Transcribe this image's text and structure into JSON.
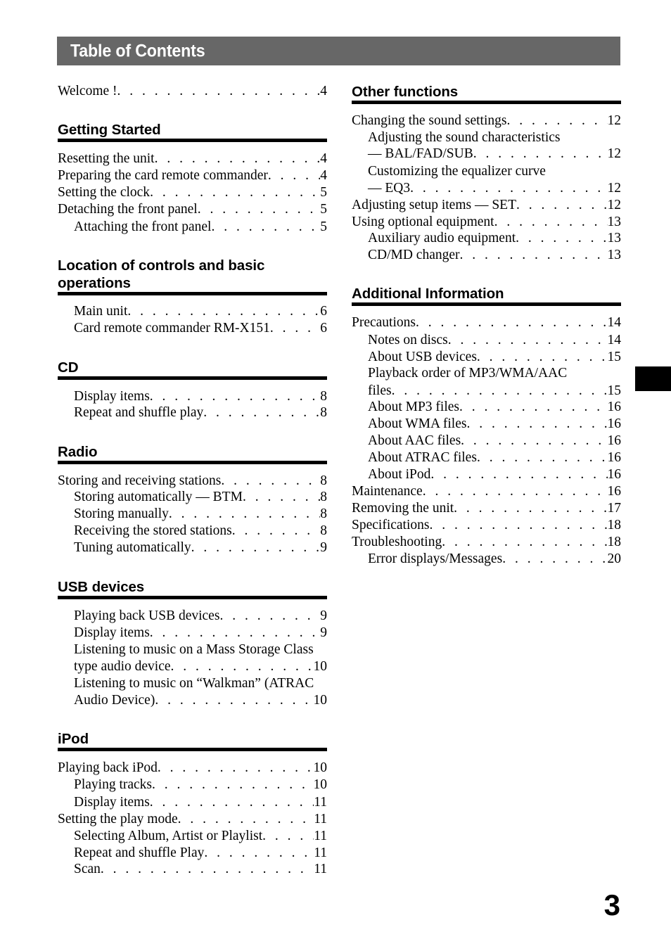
{
  "header": {
    "title": "Table of Contents"
  },
  "folio": "3",
  "columns": {
    "left": [
      {
        "type": "entries",
        "entries": [
          {
            "text": "Welcome !",
            "page": "4",
            "level": 0
          }
        ]
      },
      {
        "type": "section",
        "heading": "Getting Started",
        "entries": [
          {
            "text": "Resetting the unit",
            "page": "4",
            "level": 0,
            "tight": true
          },
          {
            "text": "Preparing the card remote commander",
            "page": "4",
            "level": 0
          },
          {
            "text": "Setting the clock",
            "page": "5",
            "level": 0
          },
          {
            "text": "Detaching the front panel",
            "page": "5",
            "level": 0
          },
          {
            "text": "Attaching the front panel",
            "page": "5",
            "level": 1
          }
        ]
      },
      {
        "type": "section",
        "heading": "Location of controls and basic\noperations",
        "entries": [
          {
            "text": "Main unit",
            "page": "6",
            "level": 1,
            "tight": true
          },
          {
            "text": "Card remote commander RM-X151",
            "page": "6",
            "level": 1
          }
        ]
      },
      {
        "type": "section",
        "heading": "CD",
        "entries": [
          {
            "text": "Display items",
            "page": "8",
            "level": 1
          },
          {
            "text": "Repeat and shuffle play",
            "page": "8",
            "level": 1,
            "tight": true
          }
        ]
      },
      {
        "type": "section",
        "heading": "Radio",
        "entries": [
          {
            "text": "Storing and receiving stations",
            "page": "8",
            "level": 0
          },
          {
            "text": "Storing automatically — BTM",
            "page": "8",
            "level": 1,
            "tight": true
          },
          {
            "text": "Storing manually",
            "page": "8",
            "level": 1,
            "tight": true
          },
          {
            "text": "Receiving the stored stations",
            "page": "8",
            "level": 1
          },
          {
            "text": "Tuning automatically",
            "page": "9",
            "level": 1
          }
        ]
      },
      {
        "type": "section",
        "heading": "USB devices",
        "entries": [
          {
            "text": "Playing back USB devices",
            "page": "9",
            "level": 1
          },
          {
            "text": "Display items",
            "page": "9",
            "level": 1
          },
          {
            "text": "Listening to music on a Mass Storage Class",
            "wrap": "type audio device",
            "page": "10",
            "level": 1
          },
          {
            "text": "Listening to music on “Walkman” (ATRAC",
            "wrap": "Audio Device)",
            "page": "10",
            "level": 1,
            "tight": true
          }
        ]
      },
      {
        "type": "section",
        "heading": "iPod",
        "entries": [
          {
            "text": "Playing back iPod",
            "page": "10",
            "level": 0
          },
          {
            "text": "Playing tracks",
            "page": "10",
            "level": 1
          },
          {
            "text": "Display items",
            "page": "11",
            "level": 1
          },
          {
            "text": "Setting the play mode",
            "page": "11",
            "level": 0
          },
          {
            "text": "Selecting Album, Artist or Playlist",
            "page": "11",
            "level": 1,
            "tight": true
          },
          {
            "text": "Repeat and shuffle Play",
            "page": "11",
            "level": 1
          },
          {
            "text": "Scan",
            "page": "11",
            "level": 1,
            "tight": true
          }
        ]
      }
    ],
    "right": [
      {
        "type": "section",
        "heading": "Other functions",
        "entries": [
          {
            "text": "Changing the sound settings",
            "page": "12",
            "level": 0,
            "tight": true
          },
          {
            "text": "Adjusting the sound characteristics",
            "level": 1,
            "plain": true
          },
          {
            "text": "— BAL/FAD/SUB",
            "page": "12",
            "level": 1,
            "tight": true
          },
          {
            "text": "Customizing the equalizer curve",
            "level": 1,
            "plain": true
          },
          {
            "text": "— EQ3",
            "page": "12",
            "level": 1
          },
          {
            "text": "Adjusting setup items — SET",
            "page": "12",
            "level": 0
          },
          {
            "text": "Using optional equipment",
            "page": "13",
            "level": 0,
            "tight": true
          },
          {
            "text": "Auxiliary audio equipment",
            "page": "13",
            "level": 1,
            "tight": true
          },
          {
            "text": "CD/MD changer",
            "page": "13",
            "level": 1,
            "tight": true
          }
        ]
      },
      {
        "type": "section",
        "heading": "Additional Information",
        "entries": [
          {
            "text": "Precautions",
            "page": "14",
            "level": 0
          },
          {
            "text": "Notes on discs",
            "page": "14",
            "level": 1
          },
          {
            "text": "About USB devices",
            "page": "15",
            "level": 1
          },
          {
            "text": "Playback order of MP3/WMA/AAC",
            "wrap": "files",
            "page": "15",
            "level": 1,
            "tight": true
          },
          {
            "text": "About MP3 files",
            "page": "16",
            "level": 1,
            "tight": true
          },
          {
            "text": "About WMA files",
            "page": "16",
            "level": 1,
            "tight": true
          },
          {
            "text": "About AAC files",
            "page": "16",
            "level": 1
          },
          {
            "text": "About ATRAC files",
            "page": "16",
            "level": 1,
            "tight": true
          },
          {
            "text": "About iPod",
            "page": "16",
            "level": 1,
            "tight": true
          },
          {
            "text": "Maintenance",
            "page": "16",
            "level": 0
          },
          {
            "text": "Removing the unit",
            "page": "17",
            "level": 0,
            "tight": true
          },
          {
            "text": "Specifications",
            "page": "18",
            "level": 0
          },
          {
            "text": "Troubleshooting",
            "page": "18",
            "level": 0
          },
          {
            "text": "Error displays/Messages",
            "page": "20",
            "level": 1,
            "tight": true
          }
        ]
      }
    ]
  }
}
